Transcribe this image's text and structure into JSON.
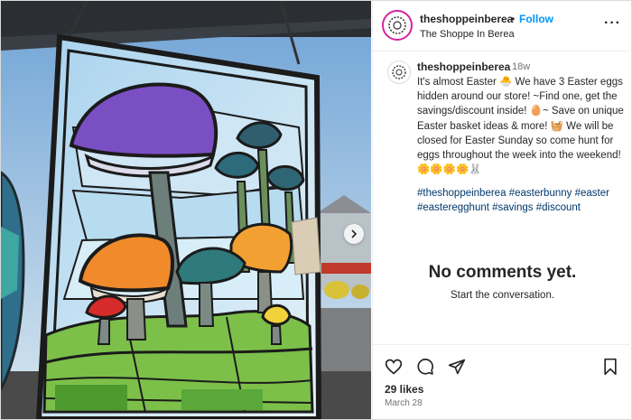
{
  "post": {
    "username": "theshoppeinberea",
    "dot": "•",
    "follow_label": "Follow",
    "subtitle": "The Shoppe In Berea",
    "time": "18w",
    "caption": "It's almost Easter 🐣 We have 3 Easter eggs hidden around our store! ~Find one, get the savings/discount inside! 🥚~ Save on unique Easter basket ideas & more! 🧺 We will be closed for Easter Sunday so come hunt for eggs throughout the week into the weekend! 🌼🌼🌼🌼🐰",
    "hashtags": [
      "#theshoppeinberea",
      "#easterbunny",
      "#easter",
      "#easteregghunt",
      "#savings",
      "#discount"
    ],
    "likes": "29 likes",
    "date": "March 28"
  },
  "comments": {
    "empty_title": "No comments yet.",
    "empty_subtitle": "Start the conversation."
  },
  "icons": {
    "more": "more-options-icon",
    "like": "heart-icon",
    "comment": "comment-icon",
    "share": "share-icon",
    "save": "bookmark-icon",
    "next": "chevron-right-icon"
  },
  "colors": {
    "follow": "#0095f6",
    "hashtag": "#00376b",
    "story_ring": "#d6249f"
  }
}
